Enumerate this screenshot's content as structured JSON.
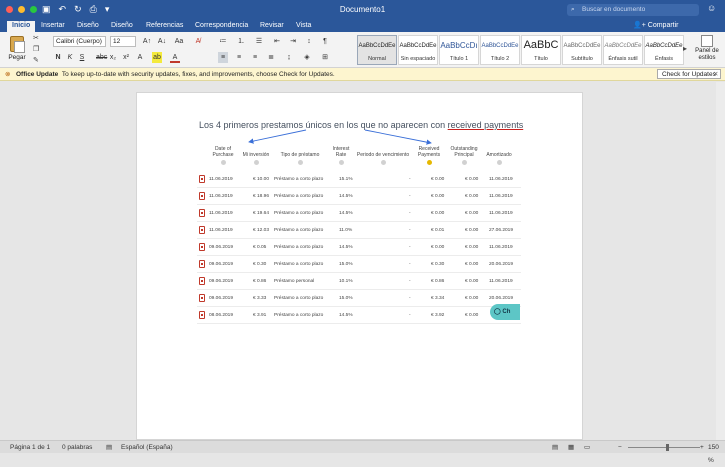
{
  "window": {
    "title": "Documento1",
    "search_placeholder": "Buscar en documento"
  },
  "tabs": [
    {
      "label": "Inicio"
    },
    {
      "label": "Insertar"
    },
    {
      "label": "Diseño"
    },
    {
      "label": "Diseño"
    },
    {
      "label": "Referencias"
    },
    {
      "label": "Correspondencia"
    },
    {
      "label": "Revisar"
    },
    {
      "label": "Vista"
    }
  ],
  "share_label": "Compartir",
  "ribbon": {
    "paste_label": "Pegar",
    "font": "Calibri (Cuerpo)",
    "size": "12",
    "styles_pane": "Panel de estilos",
    "styles": [
      {
        "sample": "AaBbCcDdEe",
        "name": "Normal"
      },
      {
        "sample": "AaBbCcDdEe",
        "name": "Sin espaciado"
      },
      {
        "sample": "AaBbCcDı",
        "name": "Título 1"
      },
      {
        "sample": "AaBbCcDdEe",
        "name": "Título 2"
      },
      {
        "sample": "AaBbC",
        "name": "Título"
      },
      {
        "sample": "AaBbCcDdEe",
        "name": "Subtítulo"
      },
      {
        "sample": "AaBbCcDdEe",
        "name": "Énfasis sutil"
      },
      {
        "sample": "AaBbCcDdEe",
        "name": "Énfasis"
      }
    ]
  },
  "message": {
    "title": "Office Update",
    "text": "To keep up-to-date with security updates, fixes, and improvements, choose Check for Updates.",
    "button": "Check for Updates"
  },
  "document": {
    "heading_pre": "Los 4 primeros prestamos únicos en los que no aparecen con ",
    "heading_link": "received payments",
    "columns": [
      "Date of Purchase",
      "Mi inversión",
      "Tipo de préstamo",
      "Interest Rate",
      "Periodo de vencimiento",
      "Received Payments",
      "Outstanding Principal",
      "Amortizado"
    ],
    "rows": [
      [
        "11.06.2019",
        "€ 10.00",
        "Préstamo a corto plazo",
        "15.1%",
        "-",
        "€ 0.00",
        "€ 0.00",
        "11.06.2019"
      ],
      [
        "11.06.2019",
        "€ 18.96",
        "Préstamo a corto plazo",
        "14.5%",
        "-",
        "€ 0.00",
        "€ 0.00",
        "11.06.2019"
      ],
      [
        "11.06.2019",
        "€ 19.64",
        "Préstamo a corto plazo",
        "14.5%",
        "-",
        "€ 0.00",
        "€ 0.00",
        "11.06.2019"
      ],
      [
        "11.06.2019",
        "€ 12.03",
        "Préstamo a corto plazo",
        "11.0%",
        "-",
        "€ 0.01",
        "€ 0.00",
        "27.06.2019"
      ],
      [
        "09.06.2019",
        "€ 0.05",
        "Préstamo a corto plazo",
        "14.5%",
        "-",
        "€ 0.00",
        "€ 0.00",
        "11.06.2019"
      ],
      [
        "09.06.2019",
        "€ 0.30",
        "Préstamo a corto plazo",
        "15.0%",
        "-",
        "€ 0.30",
        "€ 0.00",
        "20.06.2019"
      ],
      [
        "09.06.2019",
        "€ 0.86",
        "Préstamo personal",
        "10.1%",
        "-",
        "€ 0.86",
        "€ 0.00",
        "11.06.2019"
      ],
      [
        "09.06.2019",
        "€ 3.33",
        "Préstamo a corto plazo",
        "15.0%",
        "-",
        "€ 3.34",
        "€ 0.00",
        "20.06.2019"
      ],
      [
        "08.06.2019",
        "€ 3.91",
        "Préstamo a corto plazo",
        "14.5%",
        "-",
        "€ 3.92",
        "€ 0.00",
        "11.06.2019"
      ]
    ],
    "chat_label": "Ch"
  },
  "status": {
    "page": "Página 1 de 1",
    "words": "0 palabras",
    "language": "Español (España)",
    "zoom": "150 %"
  }
}
